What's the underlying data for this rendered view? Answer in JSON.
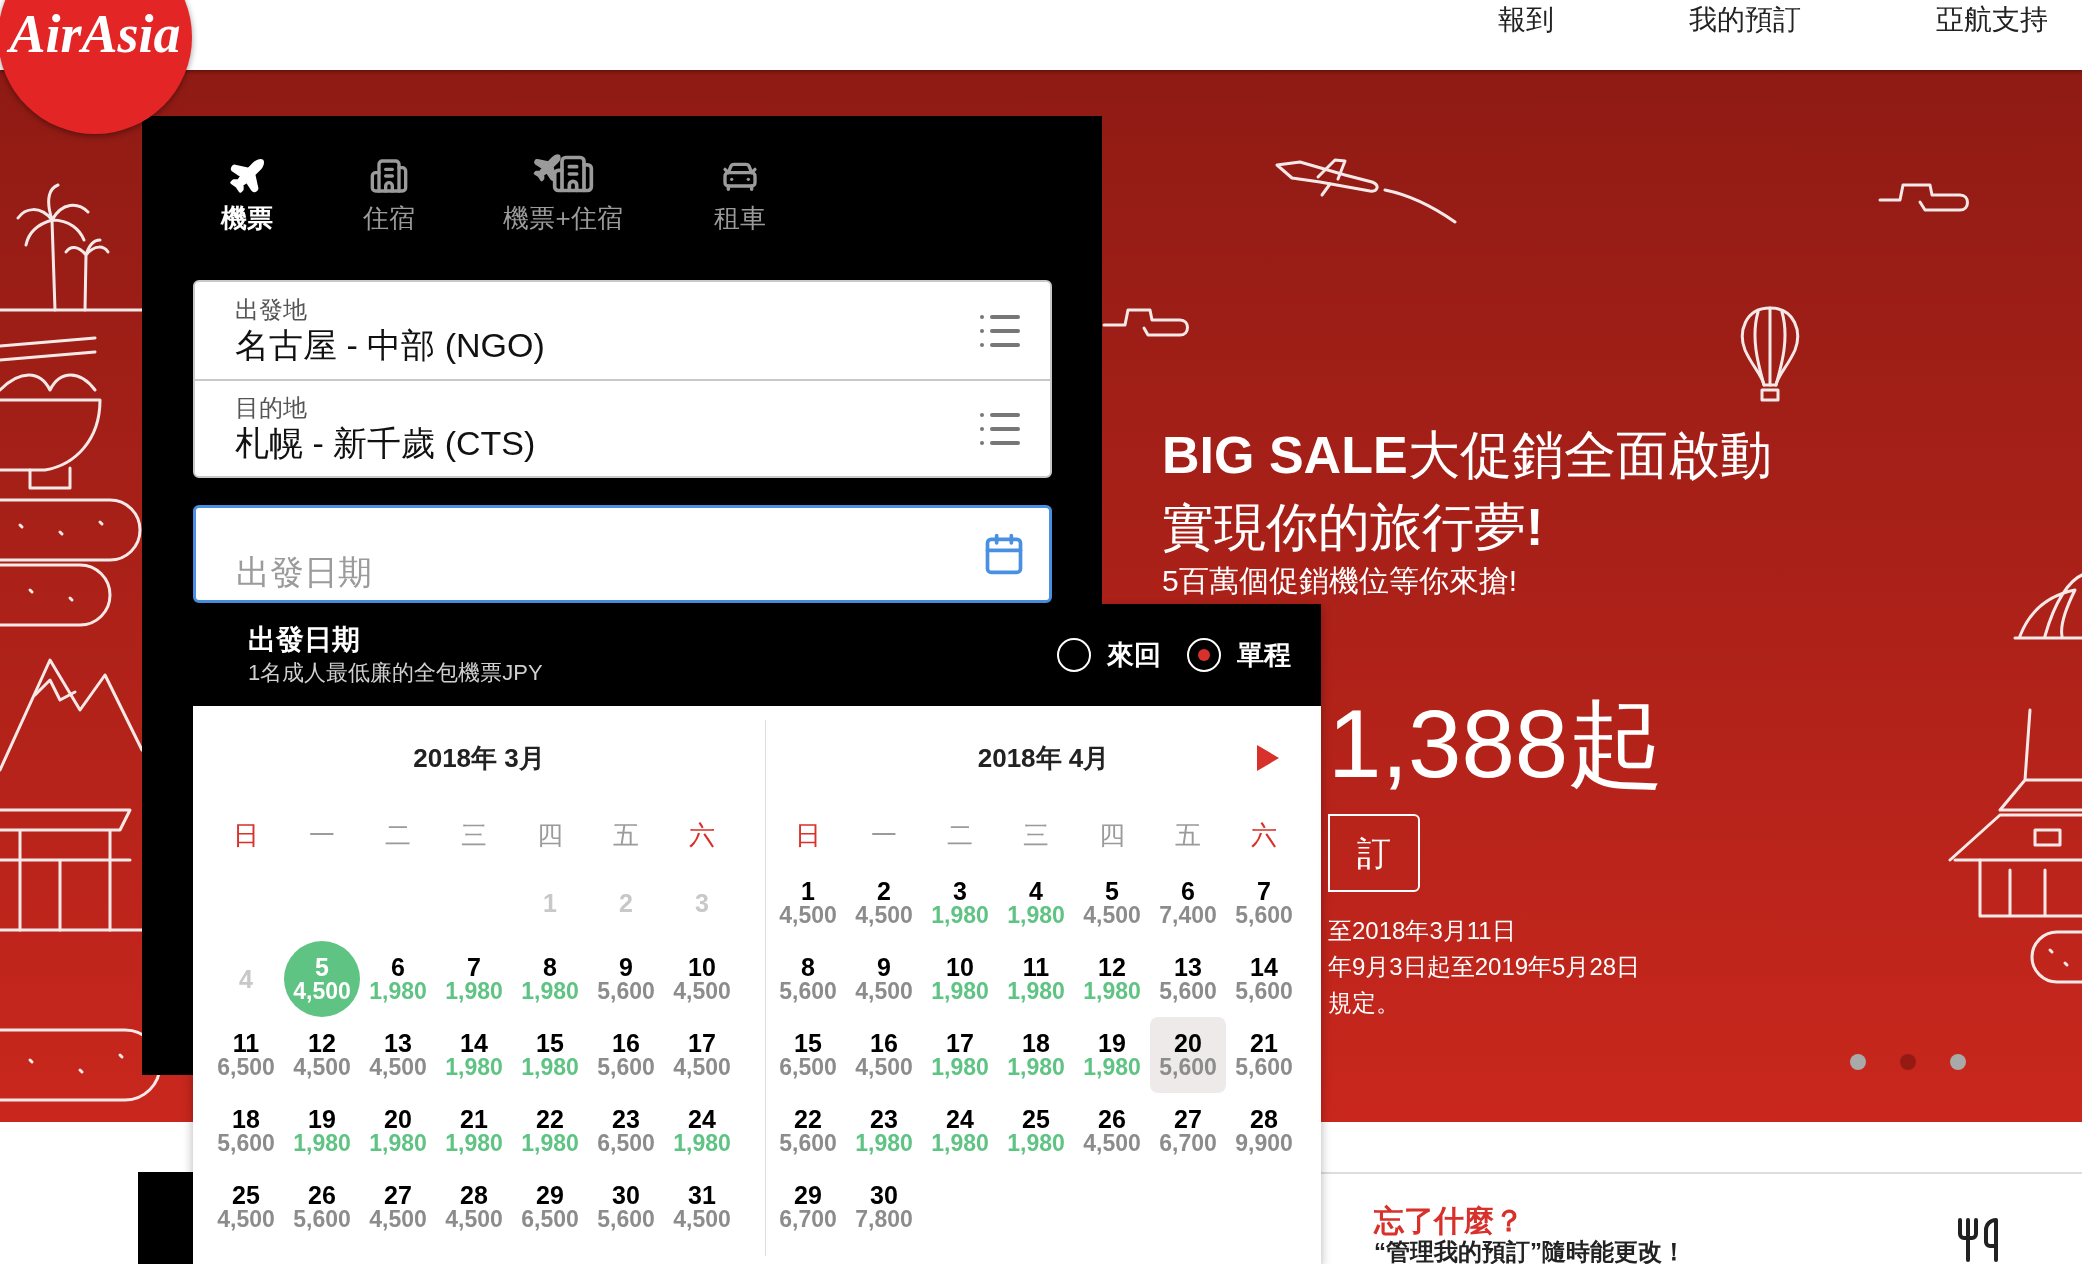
{
  "logo": {
    "text": "AirAsia"
  },
  "nav": [
    {
      "label": "報到"
    },
    {
      "label": "我的預訂"
    },
    {
      "label": "亞航支持"
    }
  ],
  "booking_tabs": [
    {
      "label": "機票",
      "kind": "flight",
      "selected": true
    },
    {
      "label": "住宿",
      "kind": "hotel",
      "selected": false
    },
    {
      "label": "機票+住宿",
      "kind": "flight_hotel",
      "selected": false
    },
    {
      "label": "租車",
      "kind": "car",
      "selected": false
    }
  ],
  "route_fields": [
    {
      "label": "出發地",
      "value": "名古屋 - 中部 (NGO)"
    },
    {
      "label": "目的地",
      "value": "札幌 - 新千歲 (CTS)"
    }
  ],
  "date_field": {
    "placeholder": "出發日期",
    "focused": true
  },
  "date_picker": {
    "title": "出發日期",
    "subtitle": "1名成人最低廉的全包機票JPY",
    "trip_types": [
      {
        "label": "來回",
        "selected": false
      },
      {
        "label": "單程",
        "selected": true
      }
    ],
    "months": [
      {
        "title": "2018年 3月",
        "has_next": false,
        "weekdays": [
          {
            "label": "日",
            "weekend": true
          },
          {
            "label": "一",
            "weekend": false
          },
          {
            "label": "二",
            "weekend": false
          },
          {
            "label": "三",
            "weekend": false
          },
          {
            "label": "四",
            "weekend": false
          },
          {
            "label": "五",
            "weekend": false
          },
          {
            "label": "六",
            "weekend": true
          }
        ],
        "weeks": [
          [
            {
              "day": "1",
              "disabled": true,
              "selected": false,
              "highlighted": false
            },
            {
              "day": "2",
              "disabled": true,
              "selected": false,
              "highlighted": false
            },
            {
              "day": "3",
              "disabled": true,
              "selected": false,
              "highlighted": false
            }
          ],
          [
            {
              "day": "4",
              "disabled": true,
              "selected": false,
              "highlighted": false
            },
            {
              "day": "5",
              "price": "4,500",
              "cheap": false,
              "disabled": false,
              "selected": true,
              "highlighted": false
            },
            {
              "day": "6",
              "price": "1,980",
              "cheap": true,
              "disabled": false,
              "selected": false,
              "highlighted": false
            },
            {
              "day": "7",
              "price": "1,980",
              "cheap": true,
              "disabled": false,
              "selected": false,
              "highlighted": false
            },
            {
              "day": "8",
              "price": "1,980",
              "cheap": true,
              "disabled": false,
              "selected": false,
              "highlighted": false
            },
            {
              "day": "9",
              "price": "5,600",
              "cheap": false,
              "disabled": false,
              "selected": false,
              "highlighted": false
            },
            {
              "day": "10",
              "price": "4,500",
              "cheap": false,
              "disabled": false,
              "selected": false,
              "highlighted": false
            }
          ],
          [
            {
              "day": "11",
              "price": "6,500",
              "cheap": false,
              "disabled": false,
              "selected": false,
              "highlighted": false
            },
            {
              "day": "12",
              "price": "4,500",
              "cheap": false,
              "disabled": false,
              "selected": false,
              "highlighted": false
            },
            {
              "day": "13",
              "price": "4,500",
              "cheap": false,
              "disabled": false,
              "selected": false,
              "highlighted": false
            },
            {
              "day": "14",
              "price": "1,980",
              "cheap": true,
              "disabled": false,
              "selected": false,
              "highlighted": false
            },
            {
              "day": "15",
              "price": "1,980",
              "cheap": true,
              "disabled": false,
              "selected": false,
              "highlighted": false
            },
            {
              "day": "16",
              "price": "5,600",
              "cheap": false,
              "disabled": false,
              "selected": false,
              "highlighted": false
            },
            {
              "day": "17",
              "price": "4,500",
              "cheap": false,
              "disabled": false,
              "selected": false,
              "highlighted": false
            }
          ],
          [
            {
              "day": "18",
              "price": "5,600",
              "cheap": false,
              "disabled": false,
              "selected": false,
              "highlighted": false
            },
            {
              "day": "19",
              "price": "1,980",
              "cheap": true,
              "disabled": false,
              "selected": false,
              "highlighted": false
            },
            {
              "day": "20",
              "price": "1,980",
              "cheap": true,
              "disabled": false,
              "selected": false,
              "highlighted": false
            },
            {
              "day": "21",
              "price": "1,980",
              "cheap": true,
              "disabled": false,
              "selected": false,
              "highlighted": false
            },
            {
              "day": "22",
              "price": "1,980",
              "cheap": true,
              "disabled": false,
              "selected": false,
              "highlighted": false
            },
            {
              "day": "23",
              "price": "6,500",
              "cheap": false,
              "disabled": false,
              "selected": false,
              "highlighted": false
            },
            {
              "day": "24",
              "price": "1,980",
              "cheap": true,
              "disabled": false,
              "selected": false,
              "highlighted": false
            }
          ],
          [
            {
              "day": "25",
              "price": "4,500",
              "cheap": false,
              "disabled": false,
              "selected": false,
              "highlighted": false
            },
            {
              "day": "26",
              "price": "5,600",
              "cheap": false,
              "disabled": false,
              "selected": false,
              "highlighted": false
            },
            {
              "day": "27",
              "price": "4,500",
              "cheap": false,
              "disabled": false,
              "selected": false,
              "highlighted": false
            },
            {
              "day": "28",
              "price": "4,500",
              "cheap": false,
              "disabled": false,
              "selected": false,
              "highlighted": false
            },
            {
              "day": "29",
              "price": "6,500",
              "cheap": false,
              "disabled": false,
              "selected": false,
              "highlighted": false
            },
            {
              "day": "30",
              "price": "5,600",
              "cheap": false,
              "disabled": false,
              "selected": false,
              "highlighted": false
            },
            {
              "day": "31",
              "price": "4,500",
              "cheap": false,
              "disabled": false,
              "selected": false,
              "highlighted": false
            }
          ]
        ]
      },
      {
        "title": "2018年 4月",
        "has_next": true,
        "weekdays": [
          {
            "label": "日",
            "weekend": true
          },
          {
            "label": "一",
            "weekend": false
          },
          {
            "label": "二",
            "weekend": false
          },
          {
            "label": "三",
            "weekend": false
          },
          {
            "label": "四",
            "weekend": false
          },
          {
            "label": "五",
            "weekend": false
          },
          {
            "label": "六",
            "weekend": true
          }
        ],
        "weeks": [
          [
            {
              "day": "1",
              "price": "4,500",
              "cheap": false,
              "disabled": false,
              "selected": false,
              "highlighted": false
            },
            {
              "day": "2",
              "price": "4,500",
              "cheap": false,
              "disabled": false,
              "selected": false,
              "highlighted": false
            },
            {
              "day": "3",
              "price": "1,980",
              "cheap": true,
              "disabled": false,
              "selected": false,
              "highlighted": false
            },
            {
              "day": "4",
              "price": "1,980",
              "cheap": true,
              "disabled": false,
              "selected": false,
              "highlighted": false
            },
            {
              "day": "5",
              "price": "4,500",
              "cheap": false,
              "disabled": false,
              "selected": false,
              "highlighted": false
            },
            {
              "day": "6",
              "price": "7,400",
              "cheap": false,
              "disabled": false,
              "selected": false,
              "highlighted": false
            },
            {
              "day": "7",
              "price": "5,600",
              "cheap": false,
              "disabled": false,
              "selected": false,
              "highlighted": false
            }
          ],
          [
            {
              "day": "8",
              "price": "5,600",
              "cheap": false,
              "disabled": false,
              "selected": false,
              "highlighted": false
            },
            {
              "day": "9",
              "price": "4,500",
              "cheap": false,
              "disabled": false,
              "selected": false,
              "highlighted": false
            },
            {
              "day": "10",
              "price": "1,980",
              "cheap": true,
              "disabled": false,
              "selected": false,
              "highlighted": false
            },
            {
              "day": "11",
              "price": "1,980",
              "cheap": true,
              "disabled": false,
              "selected": false,
              "highlighted": false
            },
            {
              "day": "12",
              "price": "1,980",
              "cheap": true,
              "disabled": false,
              "selected": false,
              "highlighted": false
            },
            {
              "day": "13",
              "price": "5,600",
              "cheap": false,
              "disabled": false,
              "selected": false,
              "highlighted": false
            },
            {
              "day": "14",
              "price": "5,600",
              "cheap": false,
              "disabled": false,
              "selected": false,
              "highlighted": false
            }
          ],
          [
            {
              "day": "15",
              "price": "6,500",
              "cheap": false,
              "disabled": false,
              "selected": false,
              "highlighted": false
            },
            {
              "day": "16",
              "price": "4,500",
              "cheap": false,
              "disabled": false,
              "selected": false,
              "highlighted": false
            },
            {
              "day": "17",
              "price": "1,980",
              "cheap": true,
              "disabled": false,
              "selected": false,
              "highlighted": false
            },
            {
              "day": "18",
              "price": "1,980",
              "cheap": true,
              "disabled": false,
              "selected": false,
              "highlighted": false
            },
            {
              "day": "19",
              "price": "1,980",
              "cheap": true,
              "disabled": false,
              "selected": false,
              "highlighted": false
            },
            {
              "day": "20",
              "price": "5,600",
              "cheap": false,
              "disabled": false,
              "selected": false,
              "highlighted": true
            },
            {
              "day": "21",
              "price": "5,600",
              "cheap": false,
              "disabled": false,
              "selected": false,
              "highlighted": false
            }
          ],
          [
            {
              "day": "22",
              "price": "5,600",
              "cheap": false,
              "disabled": false,
              "selected": false,
              "highlighted": false
            },
            {
              "day": "23",
              "price": "1,980",
              "cheap": true,
              "disabled": false,
              "selected": false,
              "highlighted": false
            },
            {
              "day": "24",
              "price": "1,980",
              "cheap": true,
              "disabled": false,
              "selected": false,
              "highlighted": false
            },
            {
              "day": "25",
              "price": "1,980",
              "cheap": true,
              "disabled": false,
              "selected": false,
              "highlighted": false
            },
            {
              "day": "26",
              "price": "4,500",
              "cheap": false,
              "disabled": false,
              "selected": false,
              "highlighted": false
            },
            {
              "day": "27",
              "price": "6,700",
              "cheap": false,
              "disabled": false,
              "selected": false,
              "highlighted": false
            },
            {
              "day": "28",
              "price": "9,900",
              "cheap": false,
              "disabled": false,
              "selected": false,
              "highlighted": false
            }
          ],
          [
            {
              "day": "29",
              "price": "6,700",
              "cheap": false,
              "disabled": false,
              "selected": false,
              "highlighted": false
            },
            {
              "day": "30",
              "price": "7,800",
              "cheap": false,
              "disabled": false,
              "selected": false,
              "highlighted": false
            }
          ]
        ]
      }
    ]
  },
  "hero": {
    "headline": [
      "**BIG SALE**大促銷全面啟動",
      "實現你的旅行夢**!**"
    ],
    "tagline": "5百萬個促銷機位等你來搶!",
    "price": "1,388起",
    "button": "訂",
    "notes": [
      "至2018年3月11日",
      "年9月3日起至2019年5月28日",
      "規定。"
    ],
    "carousel_dots": [
      {
        "selected": false
      },
      {
        "selected": true
      },
      {
        "selected": false
      }
    ]
  },
  "reminder": {
    "title": "忘了什麼？",
    "text": "“管理我的預訂”隨時能更改！"
  }
}
